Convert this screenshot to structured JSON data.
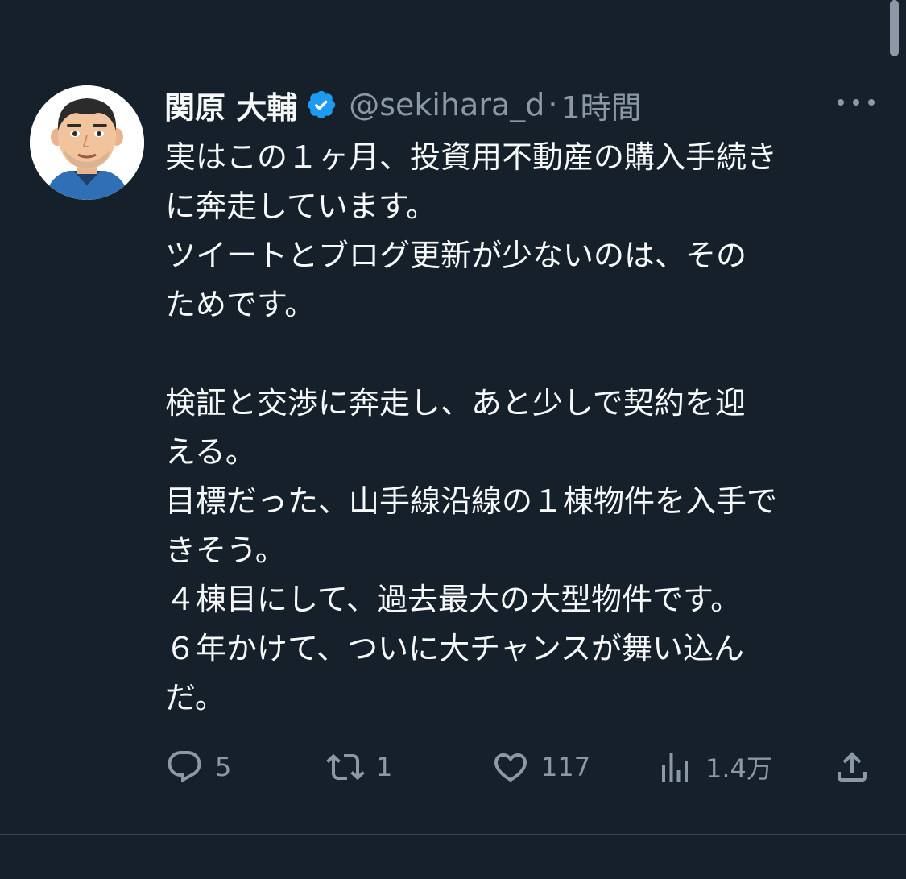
{
  "tweet": {
    "display_name": "関原 大輔",
    "handle": "@sekihara_d",
    "separator": "·",
    "time": "1時間",
    "body_lines": [
      "実はこの１ヶ月、投資用不動産の購入手続き",
      "に奔走しています。",
      "ツイートとブログ更新が少ないのは、その",
      "ためです。",
      "",
      "検証と交渉に奔走し、あと少しで契約を迎",
      "える。",
      "目標だった、山手線沿線の１棟物件を入手で",
      "きそう。",
      "４棟目にして、過去最大の大型物件です。",
      "６年かけて、ついに大チャンスが舞い込ん",
      "だ。"
    ]
  },
  "actions": {
    "reply_count": "5",
    "retweet_count": "1",
    "like_count": "117",
    "views_count": "1.4万"
  },
  "icons": {
    "verified": "verified-badge-icon",
    "more": "more-options-icon",
    "reply": "reply-icon",
    "retweet": "retweet-icon",
    "like": "heart-icon",
    "views": "bar-chart-icon",
    "share": "share-icon"
  },
  "colors": {
    "background": "#15202b",
    "text": "#f7f9f9",
    "secondary": "#8b98a5",
    "verified": "#1d9bf0"
  }
}
